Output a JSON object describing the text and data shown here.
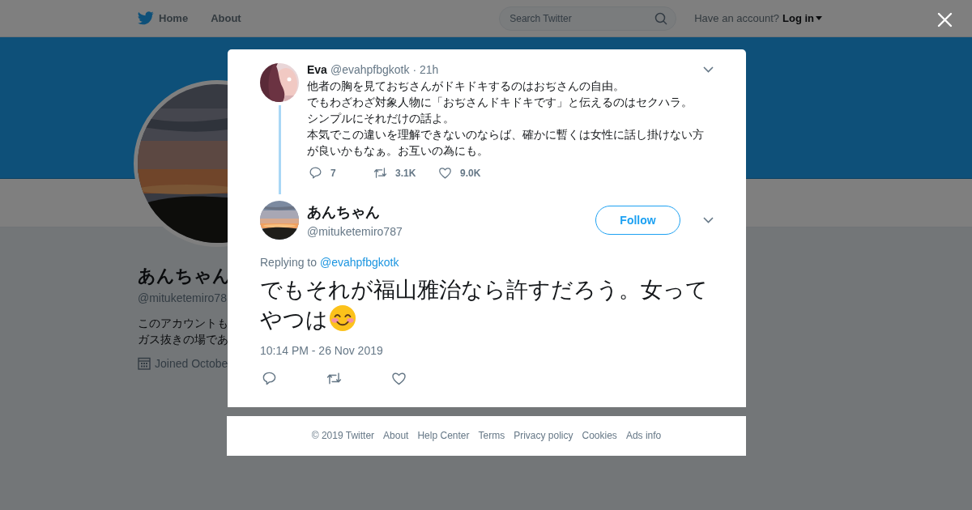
{
  "top_nav": {
    "items": [
      {
        "label": "Home",
        "kind": "home"
      },
      {
        "label": "About",
        "kind": "link"
      }
    ]
  },
  "search": {
    "placeholder": "Search Twitter"
  },
  "account": {
    "prompt": "Have an account?",
    "login": "Log in"
  },
  "profile": {
    "name": "あんちゃん",
    "handle": "@mituketemiro78",
    "bio": [
      "このアカウントも",
      "ガス抜きの場であ"
    ],
    "joined": "Joined Octobe"
  },
  "parent_tweet": {
    "name": "Eva",
    "handle": "@evahpfbgkotk",
    "time": "· 21h",
    "lines": [
      "他者の胸を見ておぢさんがドキドキするのはおぢさんの自由。",
      "でもわざわざ対象人物に「おぢさんドキドキです」と伝えるのはセクハラ。",
      "シンプルにそれだけの話よ。",
      "本気でこの違いを理解できないのならば、確かに暫くは女性に話し掛けない方が良いかもなぁ。お互いの為にも。"
    ],
    "actions": [
      {
        "kind": "reply",
        "count": "7"
      },
      {
        "kind": "retweet",
        "count": "3.1K"
      },
      {
        "kind": "like",
        "count": "9.0K"
      }
    ]
  },
  "tweet": {
    "name": "あんちゃん",
    "handle": "@mituketemiro787",
    "follow": "Follow",
    "replying_label": "Replying to",
    "replying_handle": "@evahpfbgkotk",
    "text": "でもそれが福山雅治なら許すだろう。女ってやつは",
    "timestamp": "10:14 PM - 26 Nov 2019",
    "actions": [
      {
        "kind": "reply"
      },
      {
        "kind": "retweet"
      },
      {
        "kind": "like"
      }
    ]
  },
  "footer": {
    "links": [
      "© 2019 Twitter",
      "About",
      "Help Center",
      "Terms",
      "Privacy policy",
      "Cookies",
      "Ads info"
    ]
  }
}
